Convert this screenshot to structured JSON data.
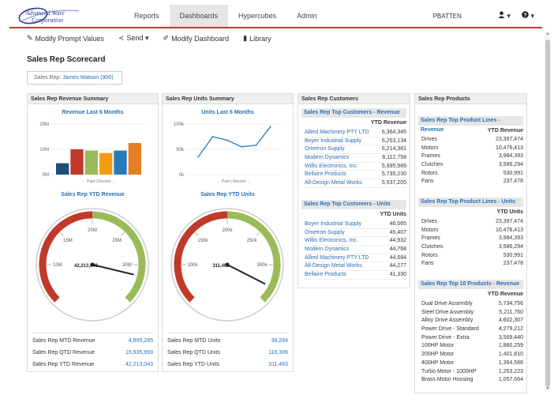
{
  "brand": {
    "line1": "Advanced Ware",
    "line2": "Corporation"
  },
  "nav": {
    "items": [
      "Reports",
      "Dashboards",
      "Hypercubes",
      "Admin"
    ],
    "active": "Dashboards"
  },
  "user": {
    "name": "PBATTEN",
    "user_icon": "user-icon",
    "help_icon": "help-icon",
    "user_caret": "▾",
    "help_caret": "▾"
  },
  "toolbar": [
    {
      "label": "Modify Prompt Values",
      "icon": "pencil-icon",
      "glyph": "✎"
    },
    {
      "label": "Send ▾",
      "icon": "share-icon",
      "glyph": "≺"
    },
    {
      "label": "Modify Dashboard",
      "icon": "edit-icon",
      "glyph": "✐"
    },
    {
      "label": "Library",
      "icon": "book-icon",
      "glyph": "▮"
    }
  ],
  "page_title": "Sales Rep Scorecard",
  "prompt": {
    "label": "Sales Rep:",
    "value": "James Watson (900)"
  },
  "revenue_panel": {
    "title": "Sales Rep Revenue Summary",
    "chart_title": "Revenue Last 6 Months",
    "gauge_title": "Sales Rep YTD Revenue",
    "gauge_value": "42,213,043",
    "gauge_needle_value": 31.5,
    "metrics": [
      {
        "label": "Sales Rep MTD Revenue",
        "value": "4,995,285"
      },
      {
        "label": "Sales Rep QTD Revenue",
        "value": "15,935,993"
      },
      {
        "label": "Sales Rep YTD Revenue",
        "value": "42,213,043"
      }
    ]
  },
  "units_panel": {
    "title": "Sales Rep Units Summary",
    "chart_title": "Units Last 6 Months",
    "gauge_title": "Sales Rep YTD Units",
    "gauge_value": "311,463",
    "gauge_needle_value": 330,
    "metrics": [
      {
        "label": "Sales Rep MTD Units",
        "value": "36,284"
      },
      {
        "label": "Sales Rep QTD Units",
        "value": "116,306"
      },
      {
        "label": "Sales Rep YTD Units",
        "value": "311,463"
      }
    ]
  },
  "chart_data": [
    {
      "type": "bar",
      "title": "Revenue Last 6 Months",
      "xlabel": "← Past | Recent →",
      "ylabel": "",
      "categories": [
        "1",
        "2",
        "3",
        "4",
        "5",
        "6"
      ],
      "values": [
        4.5,
        10,
        9.5,
        8.5,
        9.5,
        12.5
      ],
      "colors": [
        "#1f4e79",
        "#c0392b",
        "#9bbb59",
        "#f39c12",
        "#2a7ab8",
        "#e67e22"
      ],
      "ylim": [
        0,
        20
      ],
      "yticks": [
        "0M",
        "10M",
        "20M"
      ],
      "grid": true
    },
    {
      "type": "line",
      "title": "Units Last 6 Months",
      "xlabel": "← Past | Recent →",
      "ylabel": "",
      "x": [
        1,
        2,
        3,
        4,
        5,
        6
      ],
      "values": [
        35000,
        75000,
        68000,
        55000,
        58000,
        95000
      ],
      "color": "#2a7ab8",
      "ylim": [
        0,
        100000
      ],
      "yticks": [
        "0k",
        "50k",
        "100k"
      ],
      "grid": true
    },
    {
      "type": "gauge",
      "title": "Sales Rep YTD Revenue",
      "min": 5,
      "max": 35,
      "needle": 31.5,
      "ticks": [
        "10M",
        "15M",
        "20M",
        "25M",
        "30M"
      ],
      "tick_values": [
        10,
        15,
        20,
        25,
        30
      ],
      "bands": [
        {
          "from": 5,
          "to": 20,
          "color": "#c0392b"
        },
        {
          "from": 20,
          "to": 35,
          "color": "#9bbb59"
        }
      ]
    },
    {
      "type": "gauge",
      "title": "Sales Rep YTD Units",
      "min": 50,
      "max": 350,
      "needle": 330,
      "ticks": [
        "100k",
        "150k",
        "200k",
        "250k",
        "300k"
      ],
      "tick_values": [
        100,
        150,
        200,
        250,
        300
      ],
      "bands": [
        {
          "from": 50,
          "to": 200,
          "color": "#c0392b"
        },
        {
          "from": 200,
          "to": 350,
          "color": "#9bbb59"
        }
      ]
    }
  ],
  "customers_panel": {
    "title": "Sales Rep Customers",
    "revenue_table": {
      "title": "Sales Rep Top Customers - Revenue",
      "header": "YTD Revenue",
      "rows": [
        [
          "Allied Machinery PTY LTD",
          "6,364,345"
        ],
        [
          "Boyer Industrial Supply",
          "6,253,134"
        ],
        [
          "Ometron Supply",
          "6,214,381"
        ],
        [
          "Modern Dynamics",
          "6,112,758"
        ],
        [
          "Willis Electronics, Inc.",
          "5,995,989"
        ],
        [
          "Bellaire Products",
          "5,735,230"
        ],
        [
          "All-Design Metal Works",
          "5,537,205"
        ]
      ]
    },
    "units_table": {
      "title": "Sales Rep Top Customers - Units",
      "header": "YTD Units",
      "rows": [
        [
          "Boyer Industrial Supply",
          "46,065"
        ],
        [
          "Ometron Supply",
          "45,407"
        ],
        [
          "Willis Electronics, Inc.",
          "44,932"
        ],
        [
          "Modern Dynamics",
          "44,768"
        ],
        [
          "Allied Machinery PTY LTD",
          "44,684"
        ],
        [
          "All-Design Metal Works",
          "44,277"
        ],
        [
          "Bellaire Products",
          "41,330"
        ]
      ]
    }
  },
  "products_panel": {
    "title": "Sales Rep Products",
    "revenue_table": {
      "title": "Sales Rep Top Product Lines - Revenue",
      "header": "YTD Revenue",
      "rows": [
        [
          "Drives",
          "23,397,474"
        ],
        [
          "Motors",
          "10,476,413"
        ],
        [
          "Frames",
          "3,984,393"
        ],
        [
          "Clutches",
          "3,586,294"
        ],
        [
          "Rotors",
          "530,991"
        ],
        [
          "Fans",
          "237,478"
        ]
      ]
    },
    "units_table": {
      "title": "Sales Rep Top Product Lines - Units",
      "header": "YTD Units",
      "rows": [
        [
          "Drives",
          "23,397,474"
        ],
        [
          "Motors",
          "10,476,413"
        ],
        [
          "Frames",
          "3,984,393"
        ],
        [
          "Clutches",
          "3,586,294"
        ],
        [
          "Rotors",
          "530,991"
        ],
        [
          "Fans",
          "237,478"
        ]
      ]
    },
    "top10_table": {
      "title": "Sales Rep Top 10 Products - Revenue",
      "header": "YTD Revenue",
      "rows": [
        [
          "Dual Drive Assembly",
          "5,734,756"
        ],
        [
          "Steel Drive Assembly",
          "5,211,760"
        ],
        [
          "Alloy Drive Assembly",
          "4,602,307"
        ],
        [
          "Power Drive - Standard",
          "4,279,212"
        ],
        [
          "Power Drive - Extra",
          "3,569,440"
        ],
        [
          "100HP Motor",
          "1,880,259"
        ],
        [
          "200HP Motor",
          "1,401,810"
        ],
        [
          "400HP Motor",
          "1,364,566"
        ],
        [
          "Turbo Motor - 1000HP",
          "1,263,223"
        ],
        [
          "Brass Motor Housing",
          "1,057,664"
        ]
      ]
    }
  }
}
